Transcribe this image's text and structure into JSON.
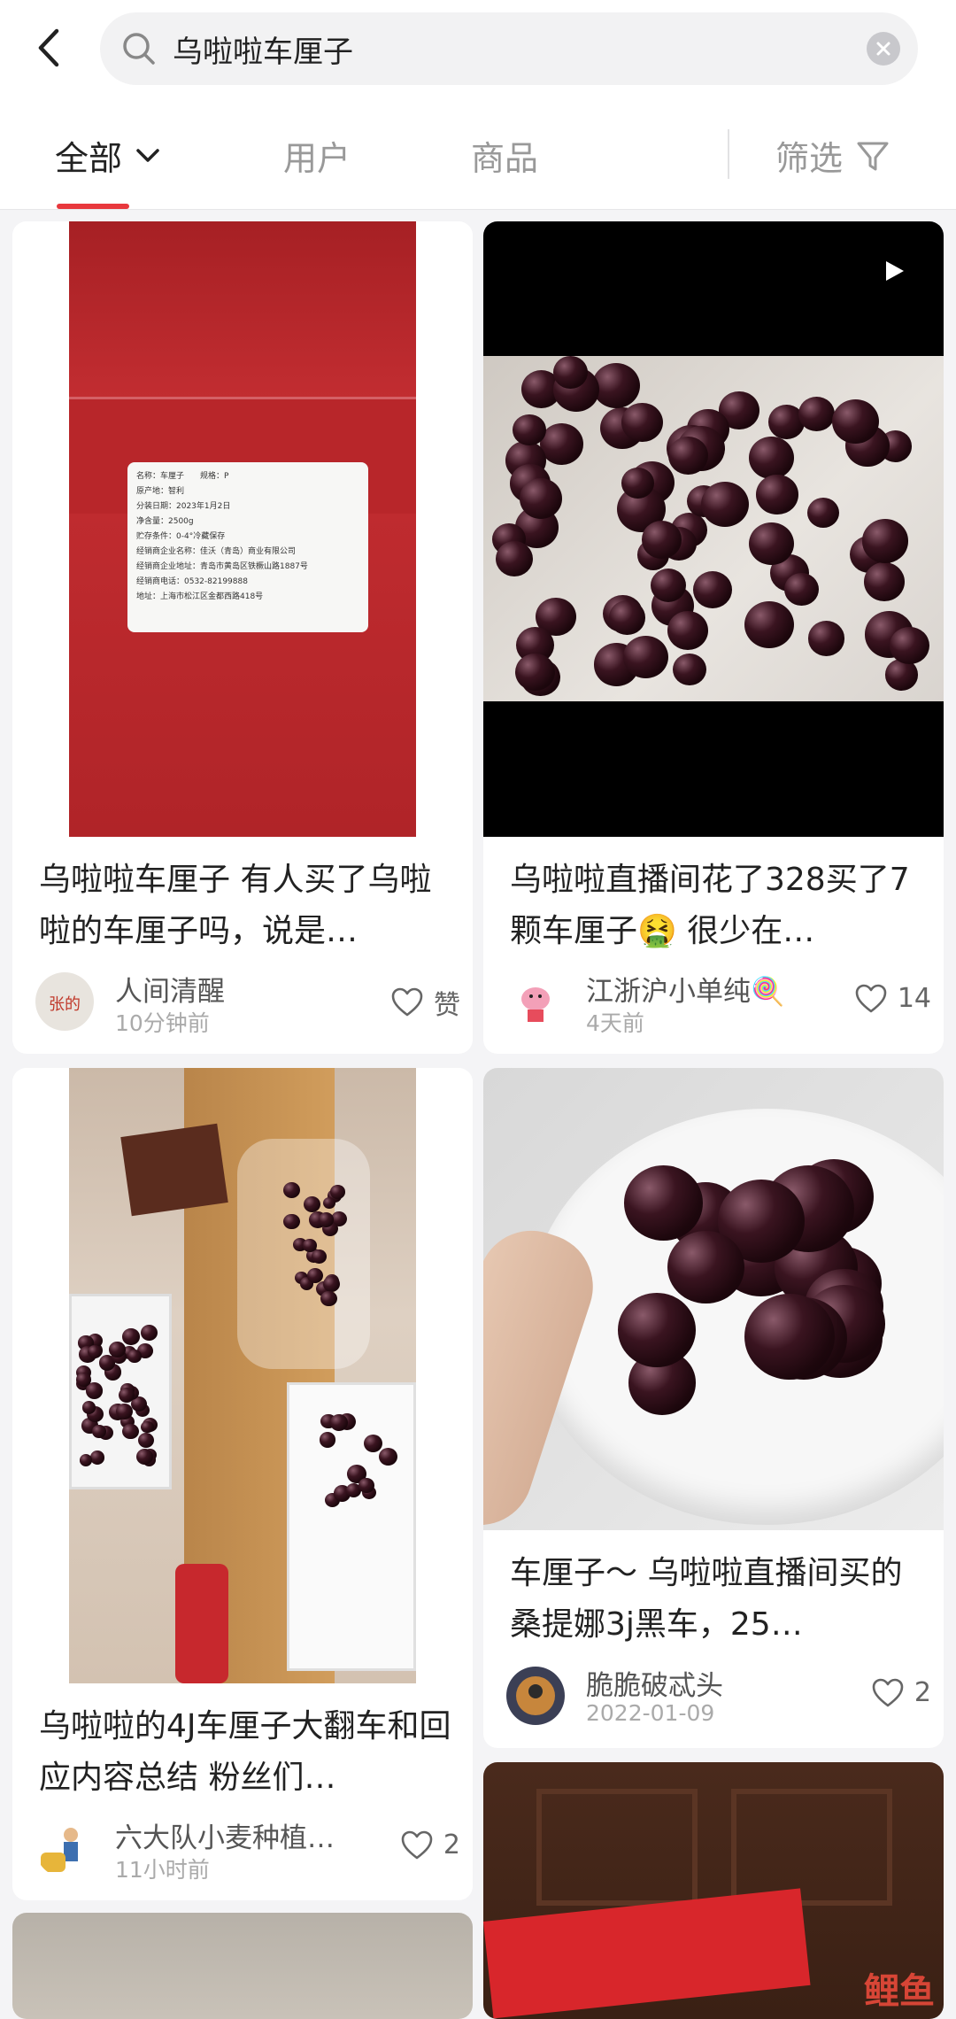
{
  "header": {
    "search_value": "乌啦啦车厘子"
  },
  "tabs": [
    {
      "label": "全部"
    },
    {
      "label": "用户"
    },
    {
      "label": "商品"
    },
    {
      "label": "筛选"
    }
  ],
  "colors": {
    "accent": "#e8383d",
    "background": "#f4f4f6"
  },
  "cards": [
    {
      "caption": "乌啦啦车厘子 有人买了乌啦啦的车厘子吗，说是…",
      "author": "人间清醒",
      "time": "10分钟前",
      "likes": "赞",
      "label_lines": [
        "名称：车厘子　　规格：P",
        "原产地：智利",
        "分装日期：2023年1月2日",
        "净含量：2500g",
        "贮存条件：0-4°冷藏保存",
        "经销商企业名称：佳沃（青岛）商业有限公司",
        "经销商企业地址：青岛市黄岛区铁橛山路1887号",
        "经销商电话：0532-82199888",
        "地址：上海市松江区金都西路418号"
      ]
    },
    {
      "caption": "乌啦啦直播间花了328买了7颗车厘子🤮 很少在…",
      "author": "江浙沪小单纯🍭",
      "time": "4天前",
      "likes": "14"
    },
    {
      "caption": "乌啦啦的4J车厘子大翻车和回应内容总结 粉丝们…",
      "author": "六大队小麦种植…",
      "time": "11小时前",
      "likes": "2"
    },
    {
      "caption": "车厘子～ 乌啦啦直播间买的桑提娜3j黑车，25…",
      "author": "脆脆破忒头",
      "time": "2022-01-09",
      "likes": "2"
    }
  ],
  "watermark": "鲤鱼"
}
